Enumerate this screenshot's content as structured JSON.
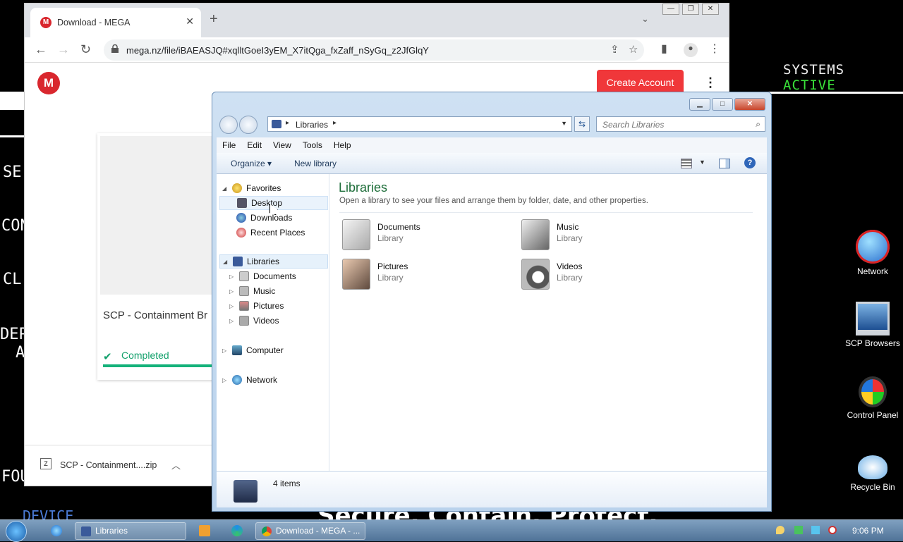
{
  "background": {
    "systems_label": "SYSTEMS",
    "active_label": "ACTIVE",
    "fragments": [
      "SE",
      "CON",
      "CL",
      "DEP",
      "A",
      "FOU",
      "DEVICE"
    ],
    "caption": "Secure. Contain. Protect."
  },
  "desktop_icons": [
    {
      "label": "Network",
      "icon": "network-globe-icon"
    },
    {
      "label": "SCP Browsers",
      "icon": "monitor-icon"
    },
    {
      "label": "Control Panel",
      "icon": "windows-logo-icon"
    },
    {
      "label": "Recycle Bin",
      "icon": "recycle-bin-icon"
    }
  ],
  "browser": {
    "tab_title": "Download - MEGA",
    "url": "mega.nz/file/iBAEASJQ#xqlltGoeI3yEM_X7itQga_fxZaff_nSyGq_z2JfGlqY",
    "page": {
      "create_account": "Create Account",
      "file_name": "SCP - Containment Br",
      "status": "Completed",
      "status_color": "#12a06b"
    },
    "download_shelf": {
      "file": "SCP - Containment....zip"
    }
  },
  "explorer": {
    "address": "Libraries",
    "search_placeholder": "Search Libraries",
    "menu": [
      "File",
      "Edit",
      "View",
      "Tools",
      "Help"
    ],
    "commands": {
      "organize": "Organize",
      "new_library": "New library"
    },
    "nav": {
      "favorites": "Favorites",
      "fav_items": [
        "Desktop",
        "Downloads",
        "Recent Places"
      ],
      "libraries": "Libraries",
      "lib_items": [
        "Documents",
        "Music",
        "Pictures",
        "Videos"
      ],
      "computer": "Computer",
      "network": "Network"
    },
    "content": {
      "title": "Libraries",
      "description": "Open a library to see your files and arrange them by folder, date, and other properties.",
      "items": [
        {
          "name": "Documents",
          "type": "Library"
        },
        {
          "name": "Music",
          "type": "Library"
        },
        {
          "name": "Pictures",
          "type": "Library"
        },
        {
          "name": "Videos",
          "type": "Library"
        }
      ]
    },
    "details": "4 items"
  },
  "taskbar": {
    "libraries": "Libraries",
    "chrome": "Download - MEGA - ...",
    "clock": "9:06 PM"
  }
}
